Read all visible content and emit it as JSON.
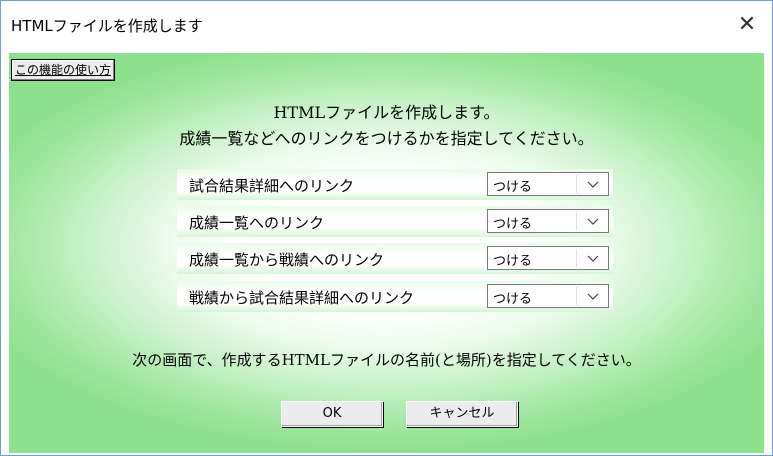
{
  "window": {
    "title": "HTMLファイルを作成します",
    "close_symbol": "✕"
  },
  "help_button": {
    "label": "この機能の使い方"
  },
  "intro": {
    "line1": "HTMLファイルを作成します。",
    "line2": "成績一覧などへのリンクをつけるかを指定してください。"
  },
  "options": [
    {
      "label": "試合結果詳細へのリンク",
      "value": "つける"
    },
    {
      "label": "成績一覧へのリンク",
      "value": "つける"
    },
    {
      "label": "成績一覧から戦績へのリンク",
      "value": "つける"
    },
    {
      "label": "戦績から試合結果詳細へのリンク",
      "value": "つける"
    }
  ],
  "bottom_text": "次の画面で、作成するHTMLファイルの名前(と場所)を指定してください。",
  "buttons": {
    "ok": "OK",
    "cancel": "キャンセル"
  },
  "icons": {
    "close": "close-icon",
    "dropdown": "chevron-down-icon"
  }
}
